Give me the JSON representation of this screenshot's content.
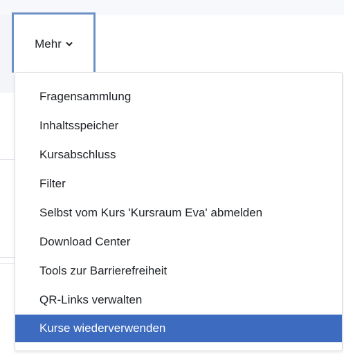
{
  "nav": {
    "more_tab_label": "Mehr",
    "more_tab_icon": "chevron-down-icon"
  },
  "dropdown": {
    "items": [
      {
        "label": "Fragensammlung"
      },
      {
        "label": "Inhaltsspeicher"
      },
      {
        "label": "Kursabschluss"
      },
      {
        "label": "Filter"
      },
      {
        "label": "Selbst vom Kurs 'Kursraum Eva' abmelden"
      },
      {
        "label": "Download Center"
      },
      {
        "label": "Tools zur Barrierefreiheit"
      },
      {
        "label": "QR-Links verwalten"
      },
      {
        "label": "Kurse wiederverwenden",
        "active": true
      }
    ]
  },
  "colors": {
    "focus_border": "#6c91c5",
    "active_item_bg": "#3d6bbf",
    "active_item_text": "#ffffff",
    "text": "#1d2125"
  }
}
